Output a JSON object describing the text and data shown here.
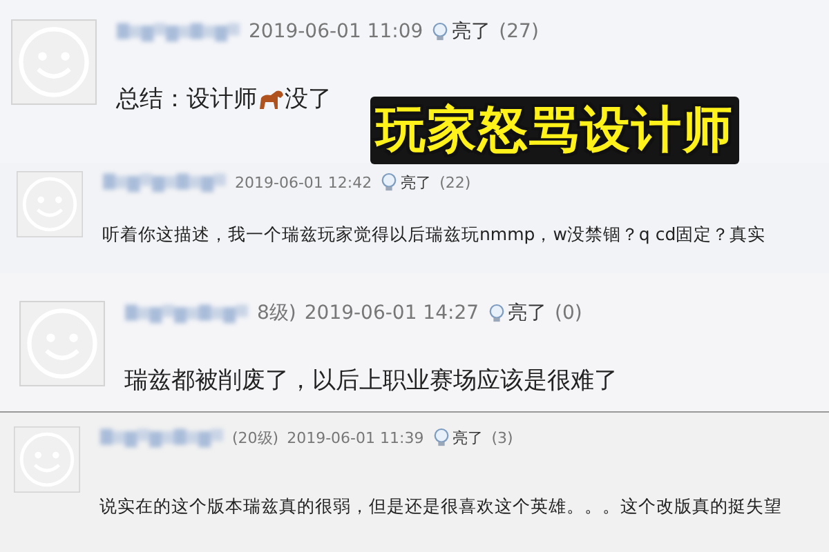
{
  "headline": "玩家怒骂设计师",
  "comments": [
    {
      "time": "2019-06-01 11:09",
      "like_label": "亮了",
      "like_count": "(27)",
      "text": "总结：设计师",
      "text_after": "没了"
    },
    {
      "time": "2019-06-01 12:42",
      "like_label": "亮了",
      "like_count": "(22)",
      "text": "听着你这描述，我一个瑞兹玩家觉得以后瑞兹玩nmmp，w没禁锢？q cd固定？真实"
    },
    {
      "level_tag": "8级)",
      "time": "2019-06-01 14:27",
      "like_label": "亮了",
      "like_count": "(0)",
      "text": "瑞兹都被削废了，以后上职业赛场应该是很难了"
    },
    {
      "level_tag": "(20级)",
      "time": "2019-06-01 11:39",
      "like_label": "亮了",
      "like_count": "(3)",
      "text": "说实在的这个版本瑞兹真的很弱，但是还是很喜欢这个英雄。。。这个改版真的挺失望"
    }
  ]
}
